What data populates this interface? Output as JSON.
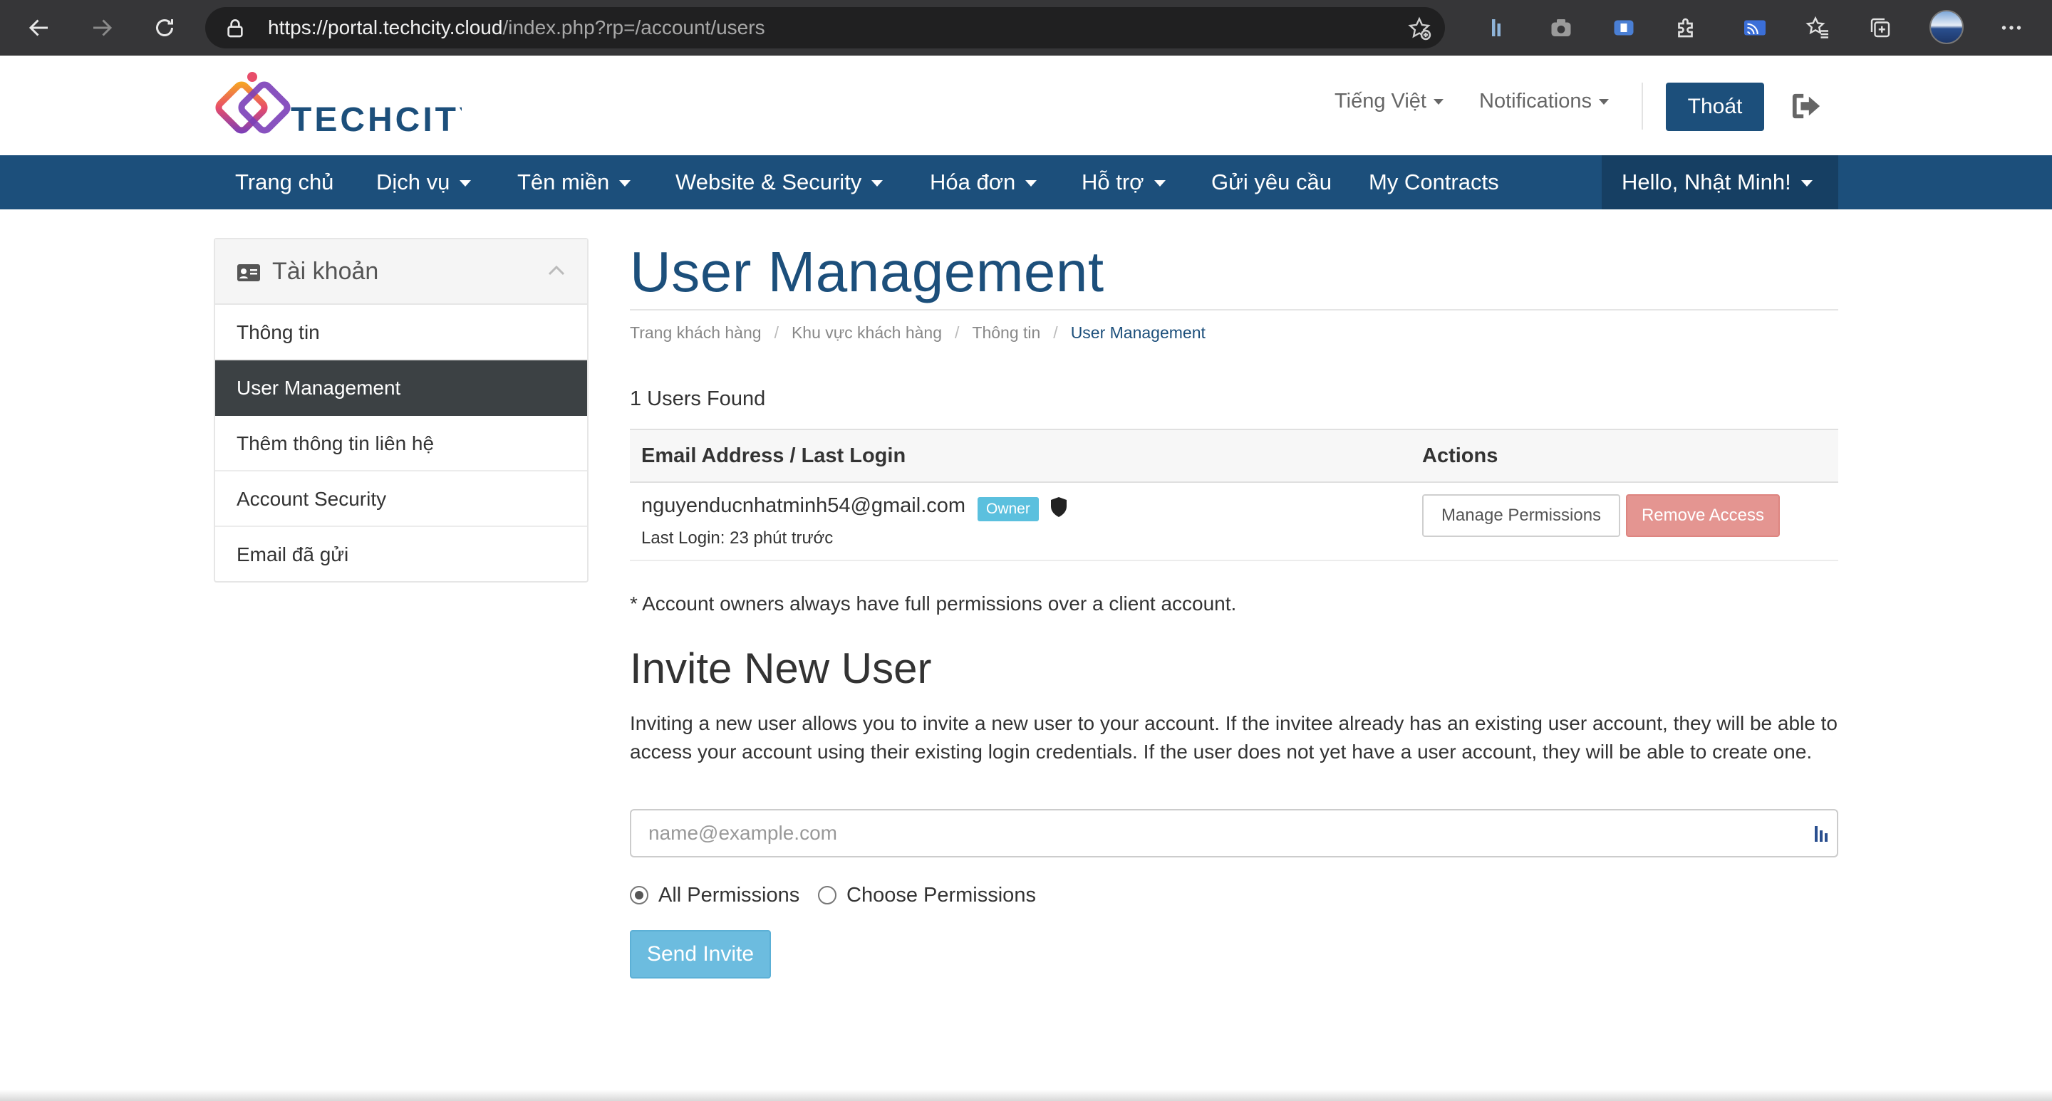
{
  "browser": {
    "url_host": "https://portal.techcity.cloud",
    "url_path": "/index.php?rp=/account/users"
  },
  "header": {
    "logo_text": "TECHCITY",
    "language": "Tiếng Việt",
    "notifications": "Notifications",
    "logout_label": "Thoát"
  },
  "nav": {
    "items": [
      {
        "label": "Trang chủ"
      },
      {
        "label": "Dịch vụ"
      },
      {
        "label": "Tên miền"
      },
      {
        "label": "Website & Security"
      },
      {
        "label": "Hóa đơn"
      },
      {
        "label": "Hỗ trợ"
      },
      {
        "label": "Gửi yêu cầu"
      },
      {
        "label": "My Contracts"
      }
    ],
    "user_greeting": "Hello, Nhật Minh!"
  },
  "sidebar": {
    "title": "Tài khoản",
    "items": [
      {
        "label": "Thông tin"
      },
      {
        "label": "User Management"
      },
      {
        "label": "Thêm thông tin liên hệ"
      },
      {
        "label": "Account Security"
      },
      {
        "label": "Email đã gửi"
      }
    ]
  },
  "main": {
    "title": "User Management",
    "breadcrumb": [
      "Trang khách hàng",
      "Khu vực khách hàng",
      "Thông tin",
      "User Management"
    ],
    "users_found": "1 Users Found",
    "table": {
      "headers": [
        "Email Address / Last Login",
        "Actions"
      ],
      "rows": [
        {
          "email": "nguyenducnhatminh54@gmail.com",
          "badge": "Owner",
          "last_login": "Last Login: 23 phút trước",
          "manage_label": "Manage Permissions",
          "remove_label": "Remove Access"
        }
      ]
    },
    "owner_note": "* Account owners always have full permissions over a client account.",
    "invite": {
      "title": "Invite New User",
      "description": "Inviting a new user allows you to invite a new user to your account. If the invitee already has an existing user account, they will be able to access your account using their existing login credentials. If the user does not yet have a user account, they will be able to create one.",
      "email_placeholder": "name@example.com",
      "email_value": "",
      "permission_options": [
        "All Permissions",
        "Choose Permissions"
      ],
      "selected_permission": "All Permissions",
      "send_label": "Send Invite"
    }
  },
  "colors": {
    "brand": "#1c4f7b",
    "sidebar_active": "#3c4144",
    "owner_badge": "#5bc0de",
    "remove_button": "#e49591",
    "send_button": "#6cbcdf"
  }
}
